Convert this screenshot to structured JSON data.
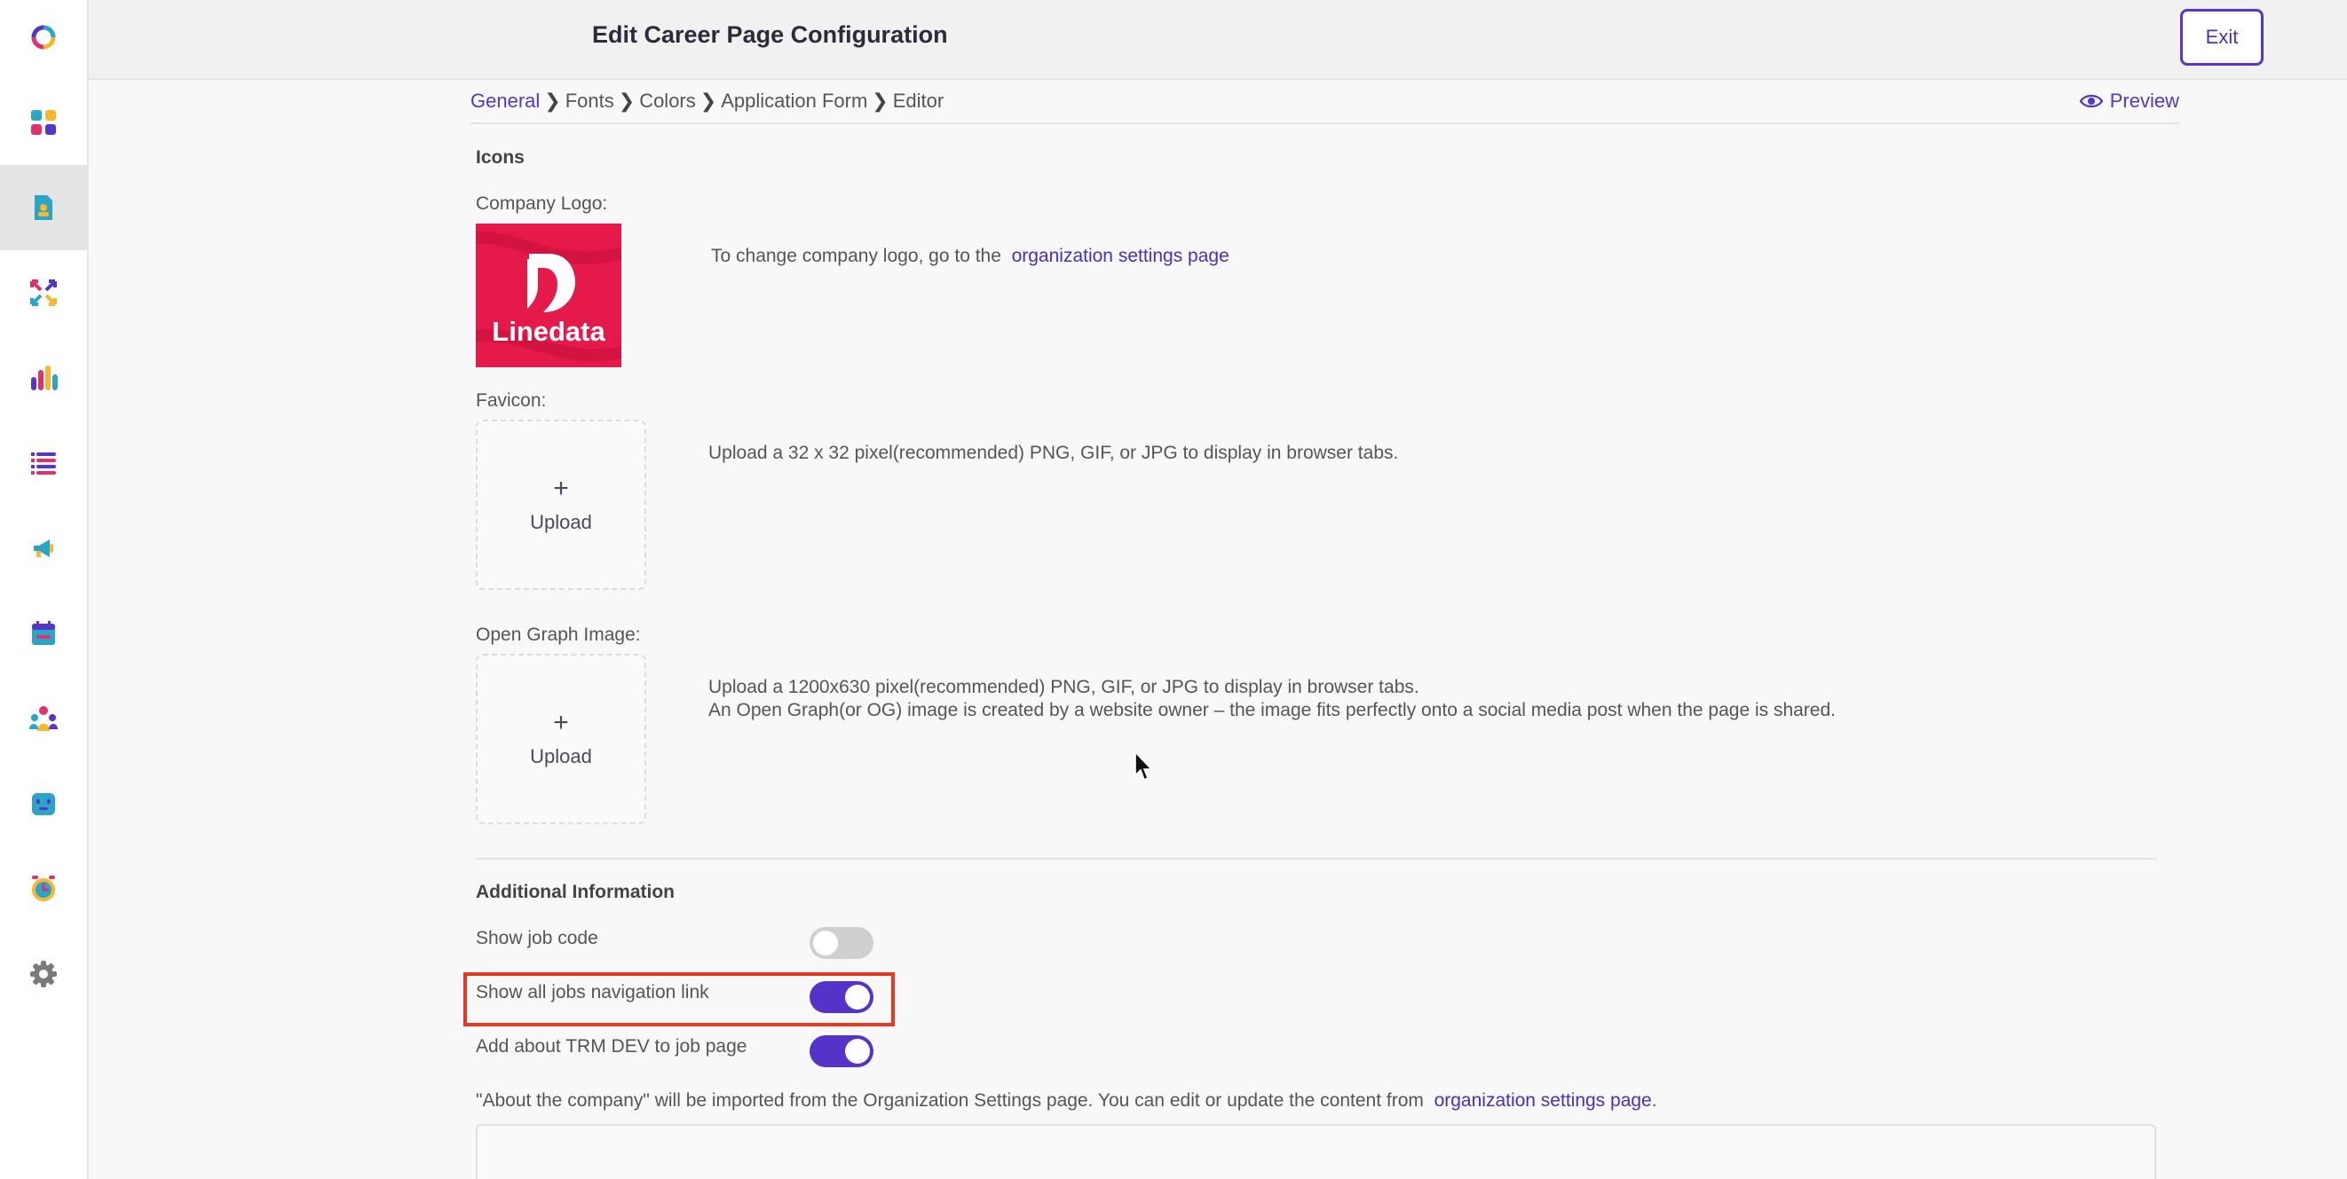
{
  "header": {
    "title": "Edit Career Page Configuration",
    "exit_label": "Exit"
  },
  "sidebar": {
    "items": [
      {
        "icon": "logo-ring-icon"
      },
      {
        "icon": "dashboard-icon"
      },
      {
        "icon": "candidate-profile-icon",
        "active": true
      },
      {
        "icon": "arrows-exchange-icon"
      },
      {
        "icon": "bar-chart-icon"
      },
      {
        "icon": "list-icon"
      },
      {
        "icon": "megaphone-icon"
      },
      {
        "icon": "calendar-icon"
      },
      {
        "icon": "team-icon"
      },
      {
        "icon": "bot-icon"
      },
      {
        "icon": "alarm-clock-icon"
      },
      {
        "icon": "gear-icon"
      }
    ]
  },
  "breadcrumb": {
    "items": [
      "General",
      "Fonts",
      "Colors",
      "Application Form",
      "Editor"
    ],
    "active": "General",
    "preview_label": "Preview"
  },
  "icons_section": {
    "title": "Icons",
    "company_logo_label": "Company Logo:",
    "logo_text": "Linedata",
    "logo_note_prefix": "To change company logo, go to the",
    "logo_note_link": "organization settings page",
    "favicon_label": "Favicon:",
    "favicon_desc": "Upload a 32 x 32 pixel(recommended) PNG, GIF, or JPG to display in browser tabs.",
    "og_label": "Open Graph Image:",
    "og_desc_1": "Upload a 1200x630 pixel(recommended) PNG, GIF, or JPG to display in browser tabs.",
    "og_desc_2": "An Open Graph(or OG) image is created by a website owner – the image fits perfectly onto a social media post when the page is shared.",
    "upload_plus": "+",
    "upload_label": "Upload"
  },
  "additional": {
    "title": "Additional Information",
    "toggles": [
      {
        "label": "Show job code",
        "on": false
      },
      {
        "label": "Show all jobs navigation link",
        "on": true
      },
      {
        "label": "Add about TRM DEV to job page",
        "on": true
      }
    ],
    "about_note_prefix": "\"About the company\" will be imported from the Organization Settings page. You can edit or update the content from",
    "about_note_link": "organization settings page",
    "about_note_suffix": "."
  },
  "colors": {
    "accent": "#5533c8",
    "highlight": "#e53a20",
    "logo_bg": "#e5194a"
  }
}
